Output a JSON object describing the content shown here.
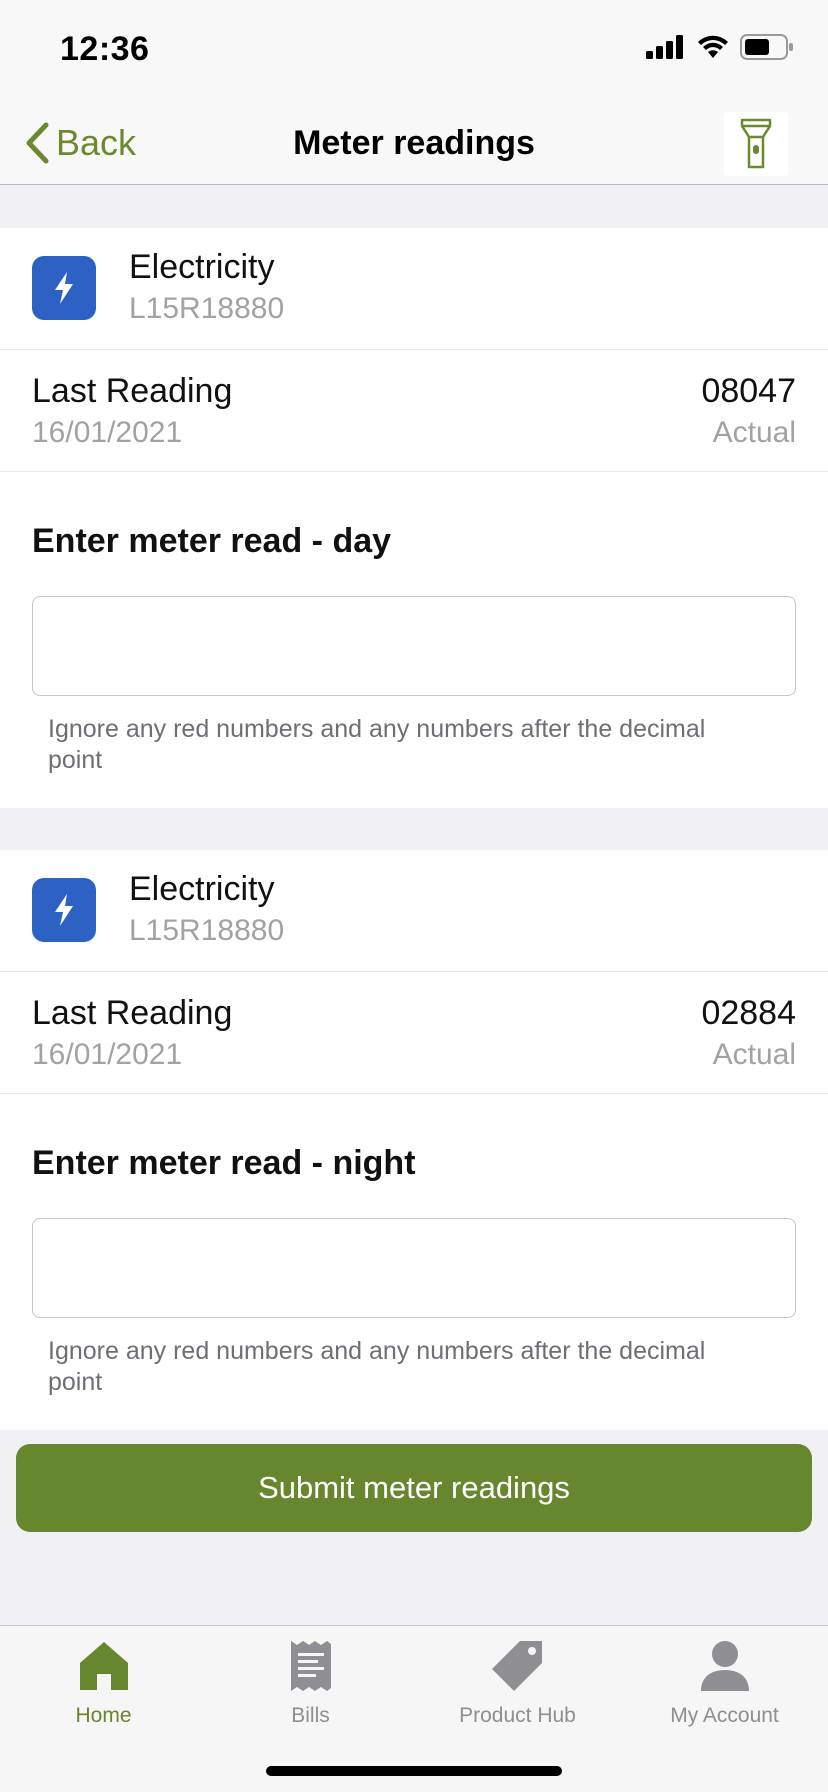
{
  "status_bar": {
    "time": "12:36"
  },
  "nav": {
    "back_label": "Back",
    "title": "Meter readings"
  },
  "meters": [
    {
      "type": "Electricity",
      "serial": "L15R18880",
      "last_reading_label": "Last Reading",
      "last_reading_date": "16/01/2021",
      "last_reading_value": "08047",
      "last_reading_type": "Actual",
      "enter_heading": "Enter meter read - day",
      "input_value": "",
      "hint": "Ignore any red numbers and any numbers after the decimal point"
    },
    {
      "type": "Electricity",
      "serial": "L15R18880",
      "last_reading_label": "Last Reading",
      "last_reading_date": "16/01/2021",
      "last_reading_value": "02884",
      "last_reading_type": "Actual",
      "enter_heading": "Enter meter read - night",
      "input_value": "",
      "hint": "Ignore any red numbers and any numbers after the decimal point"
    }
  ],
  "submit_label": "Submit meter readings",
  "tabs": [
    {
      "label": "Home",
      "icon": "home-icon",
      "active": true
    },
    {
      "label": "Bills",
      "icon": "receipt-icon",
      "active": false
    },
    {
      "label": "Product Hub",
      "icon": "tag-icon",
      "active": false
    },
    {
      "label": "My Account",
      "icon": "person-icon",
      "active": false
    }
  ],
  "colors": {
    "brand_green": "#67872e",
    "meter_icon_blue": "#2d62c4",
    "inactive_tab": "#8e8e93"
  }
}
